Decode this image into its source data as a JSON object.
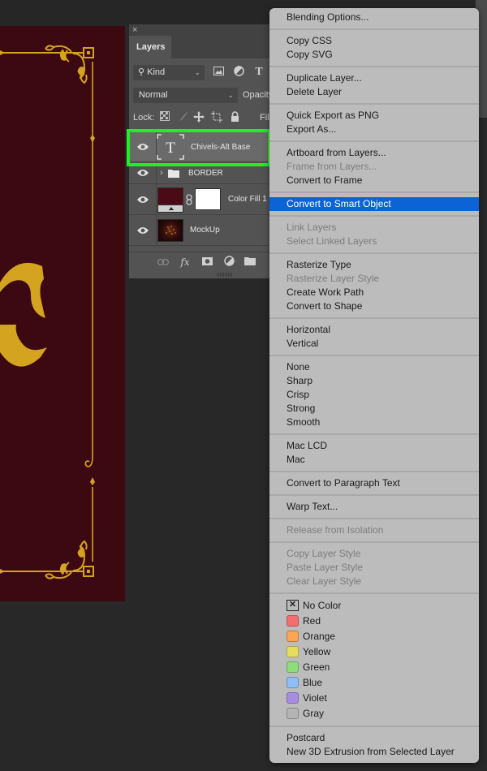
{
  "canvas": {
    "background_color": "#3c0812",
    "ornament_color": "#d4a31f",
    "letter": "C"
  },
  "layers_panel": {
    "close_label": "×",
    "tab_label": "Layers",
    "filter": {
      "kind_label": "Kind",
      "icons": [
        "image-filter-icon",
        "adjustment-filter-icon",
        "type-filter-icon"
      ]
    },
    "blend_mode": "Normal",
    "opacity_label": "Opacity",
    "lock_label": "Lock:",
    "fill_label": "Fill",
    "layers": [
      {
        "name": "Chivels-Alt Base",
        "type": "text",
        "selected": true,
        "visible": true
      },
      {
        "name": "BORDER",
        "type": "group",
        "selected": false,
        "visible": true
      },
      {
        "name": "Color Fill 1",
        "type": "fill",
        "selected": false,
        "visible": true
      },
      {
        "name": "MockUp",
        "type": "image",
        "selected": false,
        "visible": true
      }
    ],
    "highlight_color": "#22ee22"
  },
  "context_menu": {
    "groups": [
      [
        {
          "label": "Blending Options...",
          "enabled": true
        }
      ],
      [
        {
          "label": "Copy CSS",
          "enabled": true
        },
        {
          "label": "Copy SVG",
          "enabled": true
        }
      ],
      [
        {
          "label": "Duplicate Layer...",
          "enabled": true
        },
        {
          "label": "Delete Layer",
          "enabled": true
        }
      ],
      [
        {
          "label": "Quick Export as PNG",
          "enabled": true
        },
        {
          "label": "Export As...",
          "enabled": true
        }
      ],
      [
        {
          "label": "Artboard from Layers...",
          "enabled": true
        },
        {
          "label": "Frame from Layers...",
          "enabled": false
        },
        {
          "label": "Convert to Frame",
          "enabled": true
        }
      ],
      [
        {
          "label": "Convert to Smart Object",
          "enabled": true,
          "active": true
        }
      ],
      [
        {
          "label": "Link Layers",
          "enabled": false
        },
        {
          "label": "Select Linked Layers",
          "enabled": false
        }
      ],
      [
        {
          "label": "Rasterize Type",
          "enabled": true
        },
        {
          "label": "Rasterize Layer Style",
          "enabled": false
        },
        {
          "label": "Create Work Path",
          "enabled": true
        },
        {
          "label": "Convert to Shape",
          "enabled": true
        }
      ],
      [
        {
          "label": "Horizontal",
          "enabled": true
        },
        {
          "label": "Vertical",
          "enabled": true
        }
      ],
      [
        {
          "label": "None",
          "enabled": true
        },
        {
          "label": "Sharp",
          "enabled": true
        },
        {
          "label": "Crisp",
          "enabled": true
        },
        {
          "label": "Strong",
          "enabled": true
        },
        {
          "label": "Smooth",
          "enabled": true
        }
      ],
      [
        {
          "label": "Mac LCD",
          "enabled": true
        },
        {
          "label": "Mac",
          "enabled": true
        }
      ],
      [
        {
          "label": "Convert to Paragraph Text",
          "enabled": true
        }
      ],
      [
        {
          "label": "Warp Text...",
          "enabled": true
        }
      ],
      [
        {
          "label": "Release from Isolation",
          "enabled": false
        }
      ],
      [
        {
          "label": "Copy Layer Style",
          "enabled": false
        },
        {
          "label": "Paste Layer Style",
          "enabled": false
        },
        {
          "label": "Clear Layer Style",
          "enabled": false
        }
      ]
    ],
    "color_labels": [
      {
        "label": "No Color",
        "color": null
      },
      {
        "label": "Red",
        "color": "#f26f6f"
      },
      {
        "label": "Orange",
        "color": "#f9a655"
      },
      {
        "label": "Yellow",
        "color": "#e6dc5e"
      },
      {
        "label": "Green",
        "color": "#8fdc7a"
      },
      {
        "label": "Blue",
        "color": "#8fbdf6"
      },
      {
        "label": "Violet",
        "color": "#a78de0"
      },
      {
        "label": "Gray",
        "color": "#b4b4b4"
      }
    ],
    "tail_group": [
      {
        "label": "Postcard",
        "enabled": true
      },
      {
        "label": "New 3D Extrusion from Selected Layer",
        "enabled": true
      }
    ]
  }
}
